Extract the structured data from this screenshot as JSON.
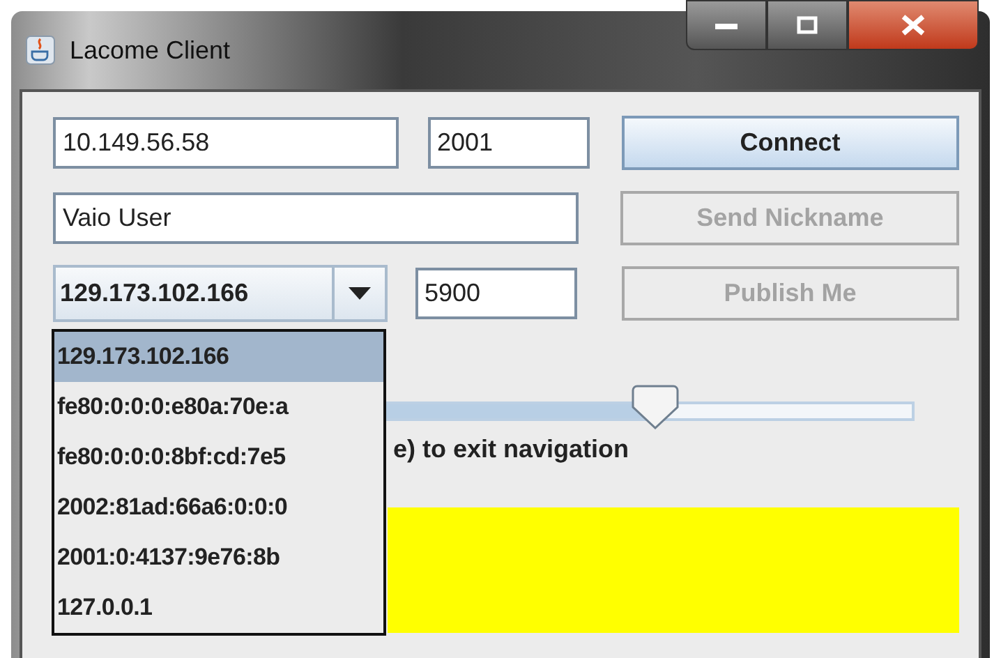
{
  "window": {
    "title": "Lacome Client"
  },
  "server": {
    "host": "10.149.56.58",
    "port": "2001",
    "connect_button": {
      "label": "Connect",
      "disabled": false
    }
  },
  "nickname": {
    "value": "Vaio User",
    "button": {
      "label": "Send Nickname",
      "disabled": true
    }
  },
  "publish": {
    "address": "129.173.102.166",
    "port": "5900",
    "button": {
      "label": "Publish Me",
      "disabled": true
    }
  },
  "address_list": [
    {
      "label": "129.173.102.166",
      "selected": true
    },
    {
      "label": "fe80:0:0:0:e80a:70e:a",
      "selected": false
    },
    {
      "label": "fe80:0:0:0:8bf:cd:7e5",
      "selected": false
    },
    {
      "label": "2002:81ad:66a6:0:0:0",
      "selected": false
    },
    {
      "label": "2001:0:4137:9e76:8b",
      "selected": false
    },
    {
      "label": "127.0.0.1",
      "selected": false
    }
  ],
  "slider": {
    "level": 0.7
  },
  "hint": "e) to exit navigation",
  "status_panel": {
    "color": "#ffff00"
  }
}
